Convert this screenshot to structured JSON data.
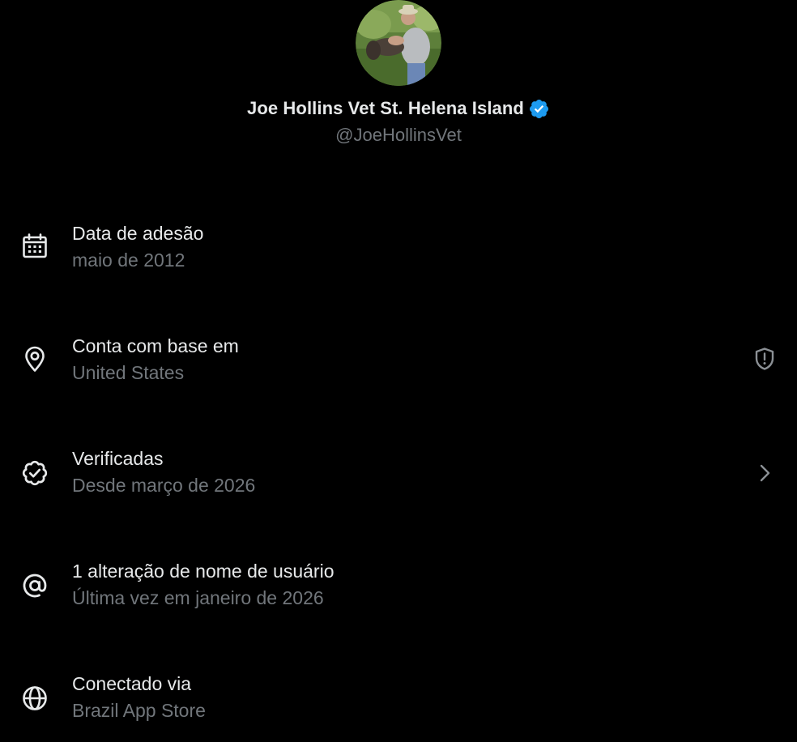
{
  "profile": {
    "display_name": "Joe Hollins Vet St. Helena Island",
    "handle": "@JoeHollinsVet",
    "verified": true,
    "verified_color": "#1d9bf0"
  },
  "about_rows": [
    {
      "icon": "calendar-icon",
      "title": "Data de adesão",
      "subtitle": "maio de 2012"
    },
    {
      "icon": "location-pin-icon",
      "title": "Conta com base em",
      "subtitle": "United States",
      "trailing_icon": "shield-alert-icon"
    },
    {
      "icon": "verified-check-icon",
      "title": "Verificadas",
      "subtitle": "Desde março de 2026",
      "trailing_icon": "chevron-right-icon"
    },
    {
      "icon": "at-sign-icon",
      "title": "1 alteração de nome de usuário",
      "subtitle": "Última vez em janeiro de 2026"
    },
    {
      "icon": "globe-icon",
      "title": "Conectado via",
      "subtitle": "Brazil App Store"
    }
  ],
  "colors": {
    "background": "#000000",
    "primary_text": "#e7e9ea",
    "secondary_text": "#71767b"
  }
}
